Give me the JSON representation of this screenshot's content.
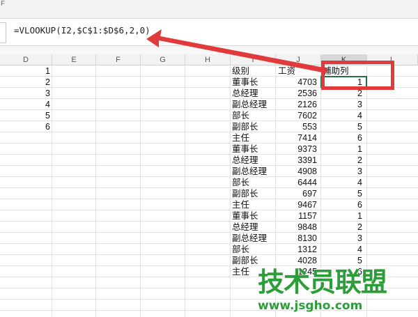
{
  "window": {
    "top_glyph": "F"
  },
  "formula_bar": {
    "formula": "=VLOOKUP(I2,$C$1:$D$6,2,0)"
  },
  "column_headers": [
    "D",
    "E",
    "F",
    "G",
    "H",
    "I",
    "J",
    "K",
    "L"
  ],
  "selected_column": "K",
  "column_d_values": [
    "1",
    "2",
    "3",
    "4",
    "5",
    "6"
  ],
  "table": {
    "headers": {
      "level": "级别",
      "salary": "工资",
      "helper": "辅助列"
    },
    "rows": [
      {
        "level": "董事长",
        "salary": "4703",
        "helper": "1"
      },
      {
        "level": "总经理",
        "salary": "2536",
        "helper": "2"
      },
      {
        "level": "副总经理",
        "salary": "2126",
        "helper": "3"
      },
      {
        "level": "部长",
        "salary": "7602",
        "helper": "4"
      },
      {
        "level": "副部长",
        "salary": "553",
        "helper": "5"
      },
      {
        "level": "主任",
        "salary": "7414",
        "helper": "6"
      },
      {
        "level": "董事长",
        "salary": "9373",
        "helper": "1"
      },
      {
        "level": "总经理",
        "salary": "3391",
        "helper": "2"
      },
      {
        "level": "副总经理",
        "salary": "4908",
        "helper": "3"
      },
      {
        "level": "部长",
        "salary": "6444",
        "helper": "4"
      },
      {
        "level": "副部长",
        "salary": "697",
        "helper": "5"
      },
      {
        "level": "主任",
        "salary": "9467",
        "helper": "6"
      },
      {
        "level": "董事长",
        "salary": "1157",
        "helper": "1"
      },
      {
        "level": "总经理",
        "salary": "9848",
        "helper": "2"
      },
      {
        "level": "副总经理",
        "salary": "8130",
        "helper": "3"
      },
      {
        "level": "部长",
        "salary": "1312",
        "helper": "4"
      },
      {
        "level": "副部长",
        "salary": "4028",
        "helper": "5"
      },
      {
        "level": "主任",
        "salary": "1245",
        "helper": "6"
      }
    ]
  },
  "watermark": {
    "title": "技术员联盟",
    "url": "www.jsgho.com"
  },
  "annotation_colors": {
    "arrow": "#e13a3a",
    "highlight_box": "#e13a3a",
    "selection": "#217346",
    "watermark": "#2d9d3a"
  }
}
